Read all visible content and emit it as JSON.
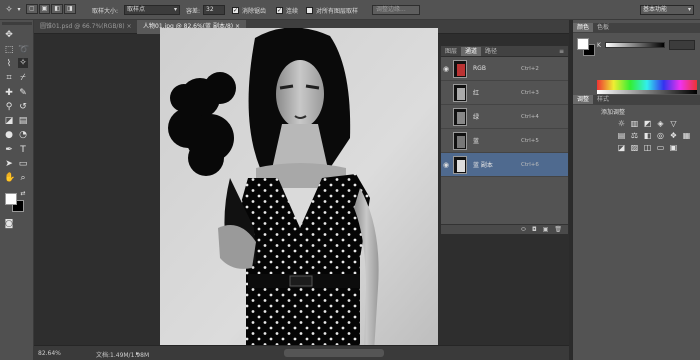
{
  "options": {
    "sample_size_label": "取样大小:",
    "sample_size_value": "取样点",
    "tolerance_label": "容差:",
    "tolerance_value": "32",
    "antialias_label": "消除锯齿",
    "contiguous_label": "连续",
    "sample_all_label": "对所有图层取样",
    "refine_edge_label": "调整边缘...",
    "workspace_label": "基本功能"
  },
  "tabs": [
    {
      "label": "圆锥01.psd @ 66.7%(RGB/8) ×",
      "active": false
    },
    {
      "label": "人物01.jpg @ 82.6%(蓝 副本/8) ×",
      "active": true
    }
  ],
  "status": {
    "zoom": "82.64%",
    "doc_info": "文档:1.49M/1.98M"
  },
  "channels_panel": {
    "tabs": [
      "图层",
      "通道",
      "路径"
    ],
    "active_tab": "通道",
    "rows": [
      {
        "name": "RGB",
        "shortcut": "Ctrl+2",
        "visible": true,
        "selected": false
      },
      {
        "name": "红",
        "shortcut": "Ctrl+3",
        "visible": false,
        "selected": false
      },
      {
        "name": "绿",
        "shortcut": "Ctrl+4",
        "visible": false,
        "selected": false
      },
      {
        "name": "蓝",
        "shortcut": "Ctrl+5",
        "visible": false,
        "selected": false
      },
      {
        "name": "蓝 副本",
        "shortcut": "Ctrl+6",
        "visible": true,
        "selected": true
      }
    ]
  },
  "color_panel": {
    "tabs": [
      "颜色",
      "色板"
    ],
    "channel_label": "K",
    "foreground": "#ffffff",
    "background": "#000000"
  },
  "adjust_panel": {
    "tabs": [
      "调整",
      "样式"
    ],
    "title": "添加调整"
  },
  "colors": {
    "selected_row": "#4f6a8f",
    "panel": "#535353",
    "workspace": "#2e2e2e"
  }
}
